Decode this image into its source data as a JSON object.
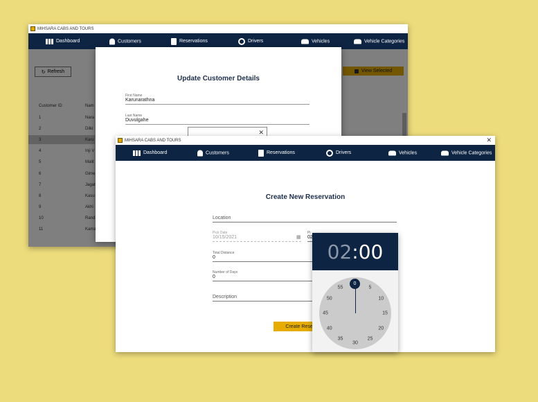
{
  "app_title": "MIHSARA CABS AND TOURS",
  "nav": {
    "dashboard": "Dashboard",
    "customers": "Customers",
    "reservations": "Reservations",
    "drivers": "Drivers",
    "vehicles": "Vehicles",
    "vehicle_categories": "Vehicle Categories"
  },
  "close_symbol": "✕",
  "back_window": {
    "refresh_label": "Refresh",
    "refresh_icon": "↻",
    "view_selected_label": "View Selected",
    "table": {
      "headers": {
        "customer_id": "Customer ID",
        "name": "Nam"
      },
      "rows": [
        {
          "id": "1",
          "name": "Nara"
        },
        {
          "id": "2",
          "name": "Dilki"
        },
        {
          "id": "3",
          "name": "Karu"
        },
        {
          "id": "4",
          "name": "Inji V"
        },
        {
          "id": "5",
          "name": "Malit"
        },
        {
          "id": "6",
          "name": "Gime"
        },
        {
          "id": "7",
          "name": "Jagat"
        },
        {
          "id": "8",
          "name": "Kasu"
        },
        {
          "id": "9",
          "name": "Akhi"
        },
        {
          "id": "10",
          "name": "Rand"
        },
        {
          "id": "11",
          "name": "Kama"
        }
      ]
    }
  },
  "update_dialog": {
    "title": "Update Customer Details",
    "first_name_label": "First Name",
    "first_name_value": "Karunarathna",
    "last_name_label": "Last Name",
    "last_name_value": "Duvulgahe"
  },
  "reservation": {
    "title": "Create New Reservation",
    "location_placeholder": "Location",
    "pick_date_label": "Pick Date",
    "pick_date_value": "10/15/2021",
    "pick_time_label": "Pi",
    "pick_time_value": "02",
    "total_distance_label": "Total Distance",
    "total_distance_value": "0",
    "number_of_days_label": "Number of Days",
    "number_of_days_value": "0",
    "description_placeholder": "Description",
    "create_button_label": "Create Reserv"
  },
  "time_picker": {
    "hour": "02",
    "separator": ":",
    "minute": "00",
    "selected_minute": "0",
    "dial_numbers": [
      "5",
      "10",
      "15",
      "20",
      "25",
      "30",
      "35",
      "40",
      "45",
      "50",
      "55"
    ]
  }
}
